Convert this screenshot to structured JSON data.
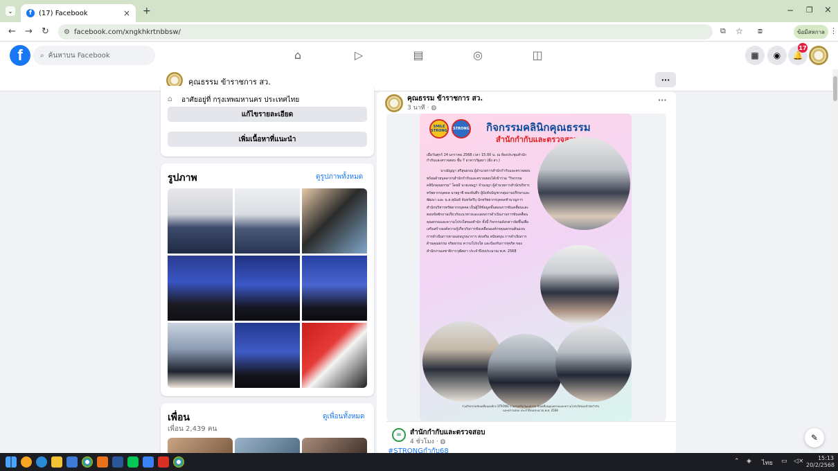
{
  "browser": {
    "tab_title": "(17) Facebook",
    "url": "facebook.com/xngkhkrtnbbsw/",
    "profile_label": "ข้อมีสหกาล"
  },
  "facebook": {
    "search_placeholder": "ค้นหาบน Facebook",
    "notification_count": "17",
    "page_name": "คุณธรรม ข้าราชการ สว."
  },
  "intro": {
    "location": "อาศัยอยู่ที่ กรุงเทพมหานคร ประเทศไทย",
    "edit_details": "แก้ไขรายละเอียด",
    "add_featured": "เพิ่มเนื้อหาที่แนะนำ"
  },
  "photos": {
    "title": "รูปภาพ",
    "see_all": "ดูรูปภาพทั้งหมด"
  },
  "friends": {
    "title": "เพื่อน",
    "see_all": "ดูเพื่อนทั้งหมด",
    "count": "เพื่อน 2,439 คน"
  },
  "post": {
    "author": "คุณธรรม ข้าราชการ สว.",
    "time": "3 นาที · ",
    "more": "···",
    "poster_title": "กิจกรรมคลินิกคุณธรรม",
    "poster_subtitle": "สำนักกำกับและตรวจสอบ",
    "logo_left": "SMILE STRONG",
    "logo_mid": "STRONG",
    "poster_intro": "เมื่อวันศุกร์ 24 มกราคม 2568 เวลา 15.00 น. ณ ห้องประชุมสำนักกำกับและตรวจสอบ ชั้น 7 อาคารรัฐสภา (ฝั่ง สว.)",
    "poster_body": "นางอัญญา สรีสุนธรณ ผู้อำนวยการสำนักกำกับและตรวจสอบ พร้อมด้วยบุคลากรสำนักกำกับและตรวจสอบได้เข้าร่วม \"กิจกรรมคลินิกคุณธรรม\" โดยมี นายเจษฎา จำนงญา ผู้อำนวยการสำนักบริหารทรัพยากรบุคคล นายฐาชี ทองจันทึก ผู้บังคับบัญชากลุ่มงานปรึกษาและพัฒนา และ น.ส.สุนันท์ จันทร์ดรีบุ นักทรัพยากรบุคคลชำนาญการ สำนักบริหารทรัพยากรบุคคล เป็นผู้ให้ข้อมูลขั้นตอนการขับเคลื่อนและตอบข้อซักถามเกี่ยวกับแนวทางและแผนการดำเนินงานการขับเคลื่อนคุณธรรมและความโปร่งใสของสำนัก ทั้งนี้ กิจกรรมดังกล่าวจัดขึ้นเพื่อเสริมสร้างองค์ความรู้เกี่ยวกับการขับเคลื่อนองค์กรคุณธรรมต้นแบบ การดำเนินการตามแผนบูรณาการ ส่งเสริม สนับสนุน การดำเนินการด้านคุณธรรม จริยธรรม ความโปร่งใส และป้องกันการทุจริต ของสำนักงานเลขาธิการวุฒิสภา ประจำปีงบประมาณ พ.ศ. 2568",
    "poster_footer": "ร่วมกิจกรรมขับเคลื่อนองค์กร STRONG ร่วมส่งเสริมวัฒนธรรม ขับเคลื่อนคุณธรรมและความโปร่งใสของสำนักกำกับและตรวจสอบ ประจำปีงบประมาณ พ.ศ. 2568"
  },
  "shared": {
    "name": "สำนักกำกับและตรวจสอบ",
    "time": "4 ชั่วโมง · ",
    "hashtag": "#STRONGกำกับ68"
  },
  "taskbar": {
    "lang": "ไทย",
    "time": "15:13",
    "date": "20/2/2568"
  },
  "colors": {
    "facebook_blue": "#1877f2",
    "tab_strip": "#d3e3c9",
    "page_background": "#f0f2f5",
    "poster_title": "#0b4a9c",
    "poster_subtitle": "#e02020"
  }
}
